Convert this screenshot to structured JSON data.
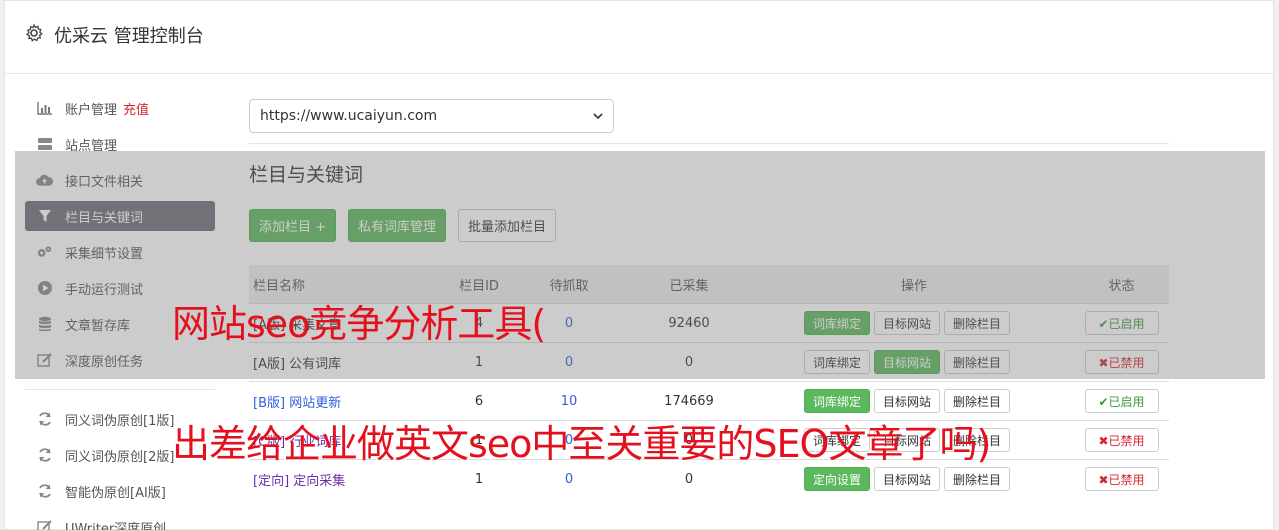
{
  "header": {
    "title": "优采云 管理控制台",
    "icon": "gear-icon"
  },
  "sidebar": {
    "items": [
      {
        "label": "账户管理",
        "extra": "充值",
        "icon": "bar-chart-icon"
      },
      {
        "label": "站点管理",
        "icon": "server-icon"
      },
      {
        "label": "接口文件相关",
        "icon": "cloud-upload-icon"
      },
      {
        "label": "栏目与关键词",
        "icon": "filter-icon",
        "active": true
      },
      {
        "label": "采集细节设置",
        "icon": "gears-icon"
      },
      {
        "label": "手动运行测试",
        "icon": "play-circle-icon"
      },
      {
        "label": "文章暂存库",
        "icon": "database-icon"
      },
      {
        "label": "深度原创任务",
        "icon": "edit-icon"
      }
    ],
    "items2": [
      {
        "label": "同义词伪原创[1版]",
        "icon": "refresh-icon"
      },
      {
        "label": "同义词伪原创[2版]",
        "icon": "refresh-icon"
      },
      {
        "label": "智能伪原创[AI版]",
        "icon": "refresh-icon"
      },
      {
        "label": "UWriter深度原创",
        "icon": "edit-icon"
      }
    ]
  },
  "main": {
    "site_select": "https://www.ucaiyun.com",
    "section_title": "栏目与关键词",
    "buttons": {
      "add": "添加栏目 +",
      "private": "私有词库管理",
      "batch": "批量添加栏目"
    },
    "columns": {
      "name": "栏目名称",
      "id": "栏目ID",
      "pending": "待抓取",
      "done": "已采集",
      "ops": "操作",
      "status": "状态"
    },
    "rows": [
      {
        "name": "[A版] 采集文章",
        "id": "4",
        "pending": "0",
        "done": "92460",
        "op1": "词库绑定",
        "op2": "目标网站",
        "op3": "删除栏目",
        "status": "✔已启用"
      },
      {
        "name": "[A版] 公有词库",
        "id": "1",
        "pending": "0",
        "done": "0",
        "op1": "词库绑定",
        "op2": "目标网站",
        "op3": "删除栏目",
        "status": "✖已禁用"
      },
      {
        "name": "[B版] 网站更新",
        "id": "6",
        "pending": "10",
        "done": "174669",
        "op1": "词库绑定",
        "op2": "目标网站",
        "op3": "删除栏目",
        "status": "✔已启用"
      },
      {
        "name": "[C版] 行业词库",
        "id": "1",
        "pending": "0",
        "done": "0",
        "op1": "词库绑定",
        "op2": "目标网站",
        "op3": "删除栏目",
        "status": "✖已禁用"
      },
      {
        "name": "[定向] 定向采集",
        "id": "1",
        "pending": "0",
        "done": "0",
        "op1": "定向设置",
        "op2": "目标网站",
        "op3": "删除栏目",
        "status": "✖已禁用"
      }
    ]
  },
  "captions": {
    "line1": "网站seo竞争分析工具(",
    "line2": "出差给企业做英文seo中至关重要的SEO文章了吗)"
  }
}
